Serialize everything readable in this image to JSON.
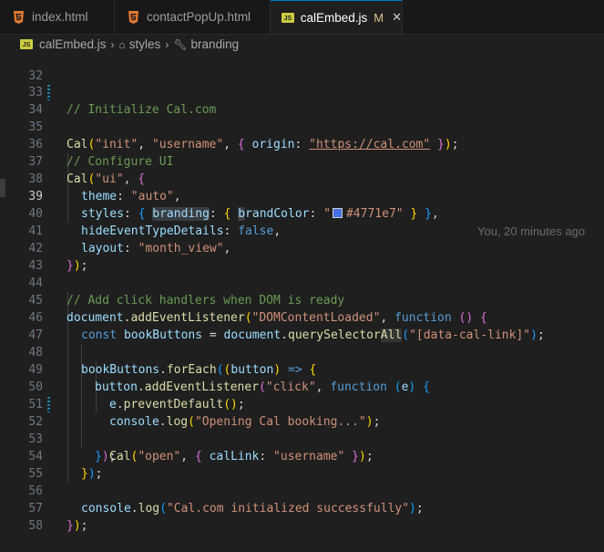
{
  "tabs": [
    {
      "label": "index.html",
      "icon": "html5-icon"
    },
    {
      "label": "contactPopUp.html",
      "icon": "html5-icon"
    },
    {
      "label": "calEmbed.js",
      "icon": "js-icon",
      "modified": "M",
      "close": "✕"
    }
  ],
  "js_badge": "JS",
  "breadcrumb": {
    "file": "calEmbed.js",
    "sep": "›",
    "items": [
      "styles",
      "branding"
    ]
  },
  "editor": {
    "current_line": 39,
    "blame": "You, 20 minutes ago",
    "color_swatch": "#4771e7",
    "line_numbers": [
      "32",
      "33",
      "34",
      "35",
      "36",
      "37",
      "38",
      "39",
      "40",
      "41",
      "42",
      "43",
      "44",
      "45",
      "46",
      "47",
      "48",
      "49",
      "50",
      "51",
      "52",
      "53",
      "54",
      "55",
      "56",
      "57",
      "58"
    ]
  },
  "code": {
    "l33": {
      "t0": "// Initialize Cal.com"
    },
    "l34": {
      "t0": "Cal",
      "t1": "(",
      "t2": "\"init\"",
      "t3": ", ",
      "t4": "\"username\"",
      "t5": ", ",
      "t6": "{",
      "t7": " origin",
      "t8": ": ",
      "t9": "\"https://cal.com\"",
      "t10": " ",
      "t11": "}",
      "t12": ")",
      "t13": ";"
    },
    "l36": {
      "t0": "// Configure UI"
    },
    "l37": {
      "t0": "Cal",
      "t1": "(",
      "t2": "\"ui\"",
      "t3": ", ",
      "t4": "{"
    },
    "l38": {
      "t0": "theme",
      "t1": ": ",
      "t2": "\"auto\"",
      "t3": ","
    },
    "l39": {
      "t0": "styles",
      "t1": ": ",
      "t2": "{",
      "t3": " ",
      "t4": "branding",
      "t5": ": ",
      "t6": "{",
      "t7": " ",
      "t8": "b",
      "t9": "randColor",
      "t10": ": ",
      "t11": "\"",
      "t12": "#4771e7\"",
      "t13": " ",
      "t14": "}",
      "t15": " ",
      "t16": "}",
      "t17": ","
    },
    "l40": {
      "t0": "hideEventTypeDetails",
      "t1": ": ",
      "t2": "false",
      "t3": ","
    },
    "l41": {
      "t0": "layout",
      "t1": ": ",
      "t2": "\"month_view\"",
      "t3": ","
    },
    "l42": {
      "t0": "}",
      "t1": ")",
      "t2": ";"
    },
    "l44": {
      "t0": "// Add click handlers when DOM is ready"
    },
    "l45": {
      "t0": "document",
      "t1": ".",
      "t2": "addEventListener",
      "t3": "(",
      "t4": "\"DOMContentLoaded\"",
      "t5": ", ",
      "t6": "function",
      "t7": " ",
      "t8": "()",
      "t9": " ",
      "t10": "{"
    },
    "l46": {
      "t0": "const",
      "t1": " ",
      "t2": "bookButtons",
      "t3": " = ",
      "t4": "document",
      "t5": ".",
      "t6": "querySelector",
      "t7": "All",
      "t8": "(",
      "t9": "\"[data-cal-link]\"",
      "t10": ")",
      "t11": ";"
    },
    "l48": {
      "t0": "bookButtons",
      "t1": ".",
      "t2": "forEach",
      "t3": "(",
      "t4": "(",
      "t5": "button",
      "t6": ")",
      "t7": " => ",
      "t8": "{"
    },
    "l49": {
      "t0": "button",
      "t1": ".",
      "t2": "addEventListener",
      "t3": "(",
      "t4": "\"click\"",
      "t5": ", ",
      "t6": "function",
      "t7": " ",
      "t8": "(",
      "t9": "e",
      "t10": ")",
      "t11": " ",
      "t12": "{"
    },
    "l50": {
      "t0": "e",
      "t1": ".",
      "t2": "preventDefault",
      "t3": "()",
      "t4": ";"
    },
    "l51": {
      "t0": "console",
      "t1": ".",
      "t2": "log",
      "t3": "(",
      "t4": "\"Opening Cal booking...\"",
      "t5": ")",
      "t6": ";"
    },
    "l52": {
      "t0": "Cal",
      "t1": "(",
      "t2": "\"open\"",
      "t3": ", ",
      "t4": "{",
      "t5": " calLink",
      "t6": ": ",
      "t7": "\"username\"",
      "t8": " ",
      "t9": "}",
      "t10": ")",
      "t11": ";"
    },
    "l53": {
      "t0": "}",
      "t1": ")",
      "t2": ";"
    },
    "l54": {
      "t0": "}",
      "t1": ")",
      "t2": ";"
    },
    "l56": {
      "t0": "console",
      "t1": ".",
      "t2": "log",
      "t3": "(",
      "t4": "\"Cal.com initialized successfully\"",
      "t5": ")",
      "t6": ";"
    },
    "l57": {
      "t0": "}",
      "t1": ")",
      "t2": ";"
    }
  }
}
